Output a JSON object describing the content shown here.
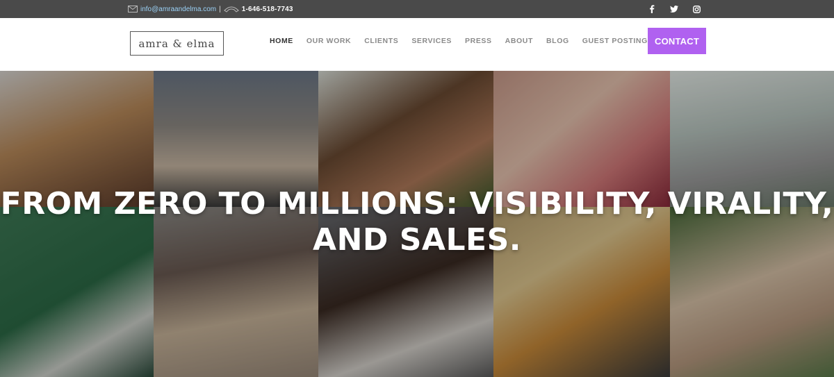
{
  "topbar": {
    "email": "info@amraandelma.com",
    "separator": "|",
    "phone": "1-646-518-7743",
    "social_icons": [
      "facebook-icon",
      "twitter-icon",
      "instagram-icon"
    ]
  },
  "header": {
    "logo_text": "amra & elma",
    "nav": [
      "HOME",
      "OUR WORK",
      "CLIENTS",
      "SERVICES",
      "PRESS",
      "ABOUT",
      "BLOG",
      "GUEST POSTING"
    ],
    "contact_label": "CONTACT"
  },
  "hero": {
    "title_line1": "FROM ZERO TO MILLIONS: VISIBILITY, VIRALITY,",
    "title_line2": "AND SALES."
  },
  "colors": {
    "topbar_bg": "#4a4a4a",
    "accent": "#b061f0",
    "nav_active": "#333333",
    "nav_text": "#8a8a8a"
  }
}
